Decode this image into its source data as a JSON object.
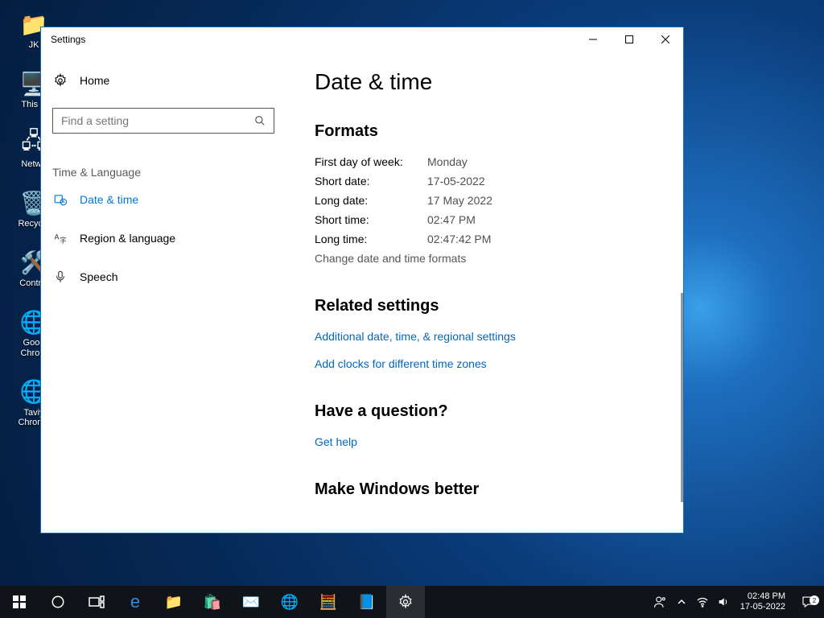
{
  "desktop_icons": [
    {
      "name": "user-folder",
      "label": "JK"
    },
    {
      "name": "this-pc",
      "label": "This P"
    },
    {
      "name": "network",
      "label": "Netwo"
    },
    {
      "name": "recycle-bin",
      "label": "Recycle"
    },
    {
      "name": "control-panel",
      "label": "Control"
    },
    {
      "name": "chrome1",
      "label": "Goog\nChrom"
    },
    {
      "name": "chrome2",
      "label": "Taviy\nChrome"
    }
  ],
  "window": {
    "title": "Settings",
    "home_label": "Home",
    "search_placeholder": "Find a setting",
    "category": "Time & Language",
    "nav": [
      {
        "id": "date-time",
        "label": "Date & time",
        "active": true
      },
      {
        "id": "region-language",
        "label": "Region & language",
        "active": false
      },
      {
        "id": "speech",
        "label": "Speech",
        "active": false
      }
    ],
    "page_title": "Date & time",
    "formats": {
      "heading": "Formats",
      "rows": [
        {
          "k": "First day of week:",
          "v": "Monday"
        },
        {
          "k": "Short date:",
          "v": "17-05-2022"
        },
        {
          "k": "Long date:",
          "v": "17 May 2022"
        },
        {
          "k": "Short time:",
          "v": "02:47 PM"
        },
        {
          "k": "Long time:",
          "v": "02:47:42 PM"
        }
      ],
      "change_link": "Change date and time formats"
    },
    "related": {
      "heading": "Related settings",
      "links": [
        "Additional date, time, & regional settings",
        "Add clocks for different time zones"
      ]
    },
    "question": {
      "heading": "Have a question?",
      "link": "Get help"
    },
    "feedback_heading": "Make Windows better"
  },
  "taskbar": {
    "time": "02:48 PM",
    "date": "17-05-2022",
    "notif_count": "2"
  }
}
